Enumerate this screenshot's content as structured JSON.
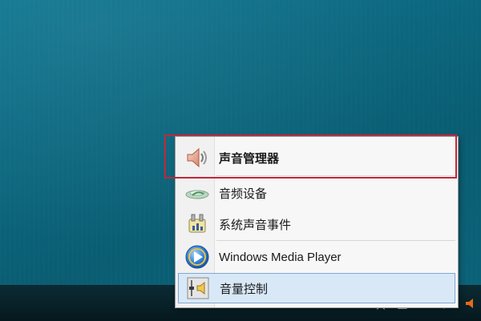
{
  "menu": {
    "items": [
      {
        "label": "声音管理器",
        "icon": "speaker-icon",
        "bold": true,
        "highlighted": false
      },
      {
        "label": "音频设备",
        "icon": "audio-device-icon",
        "bold": false,
        "highlighted": false
      },
      {
        "label": "系统声音事件",
        "icon": "sound-events-icon",
        "bold": false,
        "highlighted": false
      },
      {
        "label": "Windows Media Player",
        "icon": "media-player-icon",
        "bold": false,
        "highlighted": false
      },
      {
        "label": "音量控制",
        "icon": "volume-control-icon",
        "bold": false,
        "highlighted": true
      }
    ]
  },
  "annotation": {
    "color": "#c0273b"
  },
  "tray": {
    "icons": [
      "network-icon",
      "play-icon",
      "star-icon",
      "copy-icon",
      "refresh-icon",
      "arrow-icon",
      "speaker-tray-icon"
    ]
  }
}
